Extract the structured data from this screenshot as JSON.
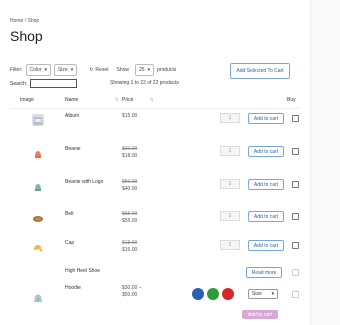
{
  "breadcrumb": "Home / Shop",
  "title": "Shop",
  "filters": {
    "label": "Filter:",
    "color": "Color",
    "size": "Size",
    "reset": "Reset",
    "show_label": "Show",
    "show_value": "25",
    "show_suffix": "products"
  },
  "add_selected": "Add Selected To Cart",
  "search_label": "Search:",
  "search_value": "",
  "showing": "Showing 1 to 22 of 22 products",
  "columns": {
    "image": "Image",
    "name": "Name",
    "price": "Price",
    "buy": "Buy"
  },
  "add_to_cart": "Add to cart",
  "read_more": "Read more",
  "size_select": "Size",
  "colors": {
    "accent": "#2a64a8",
    "swatch_blue": "#2b5fb7",
    "swatch_green": "#2d9b3a",
    "swatch_red": "#d62828",
    "disabled_cart": "#d7a8d4"
  },
  "products": [
    {
      "name": "Album",
      "price": "$15.00",
      "qty": "1"
    },
    {
      "name": "Beanie",
      "old_price": "$20.00",
      "price": "$18.00",
      "qty": "1"
    },
    {
      "name": "Beanie with Logo",
      "old_price": "$50.00",
      "price": "$40.00",
      "qty": "1"
    },
    {
      "name": "Belt",
      "old_price": "$65.00",
      "price": "$55.00",
      "qty": "1"
    },
    {
      "name": "Cap",
      "old_price": "$18.00",
      "price": "$16.00",
      "qty": "1"
    },
    {
      "name": "High Heel Shoe"
    },
    {
      "name": "Hoodie",
      "price_from": "$30.00 –",
      "price_to": "$50.00"
    }
  ]
}
